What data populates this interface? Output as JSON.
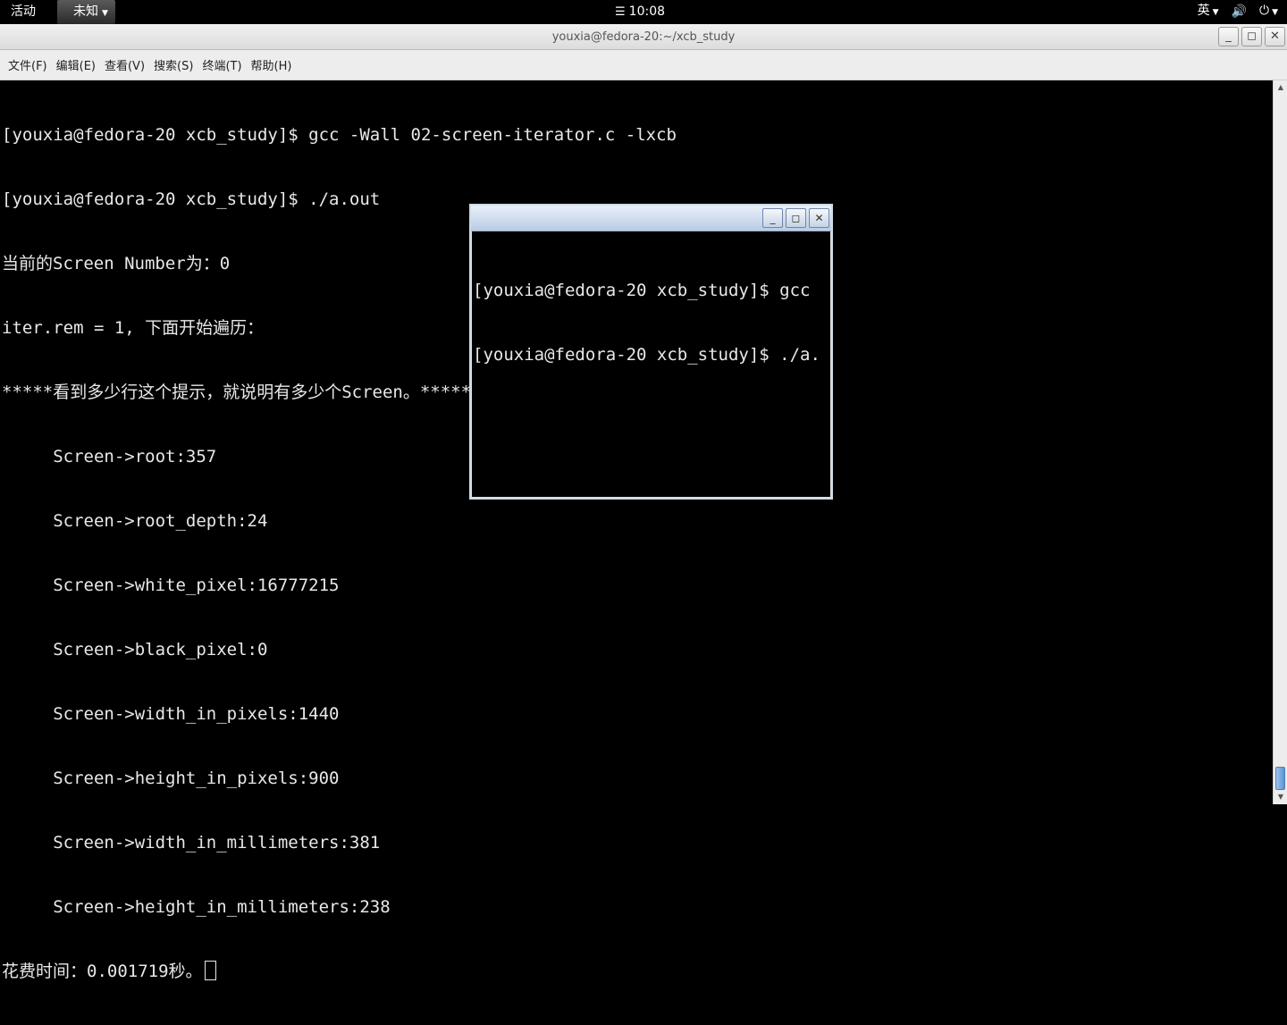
{
  "top_panel": {
    "activities_label": "活动",
    "app_menu_label": "未知",
    "clock_icon": "calendar-icon",
    "clock_time": "10:08",
    "input_method_label": "英",
    "volume_icon": "volume-icon",
    "power_icon": "power-icon"
  },
  "terminal_window": {
    "title": "youxia@fedora-20:~/xcb_study",
    "menus": [
      "文件(F)",
      "编辑(E)",
      "查看(V)",
      "搜索(S)",
      "终端(T)",
      "帮助(H)"
    ],
    "lines": [
      "[youxia@fedora-20 xcb_study]$ gcc -Wall 02-screen-iterator.c -lxcb",
      "[youxia@fedora-20 xcb_study]$ ./a.out",
      "当前的Screen Number为：0",
      "iter.rem = 1, 下面开始遍历：",
      "*****看到多少行这个提示，就说明有多少个Screen。*****",
      "     Screen->root:357",
      "     Screen->root_depth:24",
      "     Screen->white_pixel:16777215",
      "     Screen->black_pixel:0",
      "     Screen->width_in_pixels:1440",
      "     Screen->height_in_pixels:900",
      "     Screen->width_in_millimeters:381",
      "     Screen->height_in_millimeters:238",
      "花费时间：0.001719秒。"
    ]
  },
  "xcb_window": {
    "lines": [
      "[youxia@fedora-20 xcb_study]$ gcc",
      "[youxia@fedora-20 xcb_study]$ ./a."
    ]
  },
  "colors": {
    "terminal_bg": "#000000",
    "terminal_fg": "#e8e8e8",
    "scroll_thumb": "#5b93d3"
  }
}
